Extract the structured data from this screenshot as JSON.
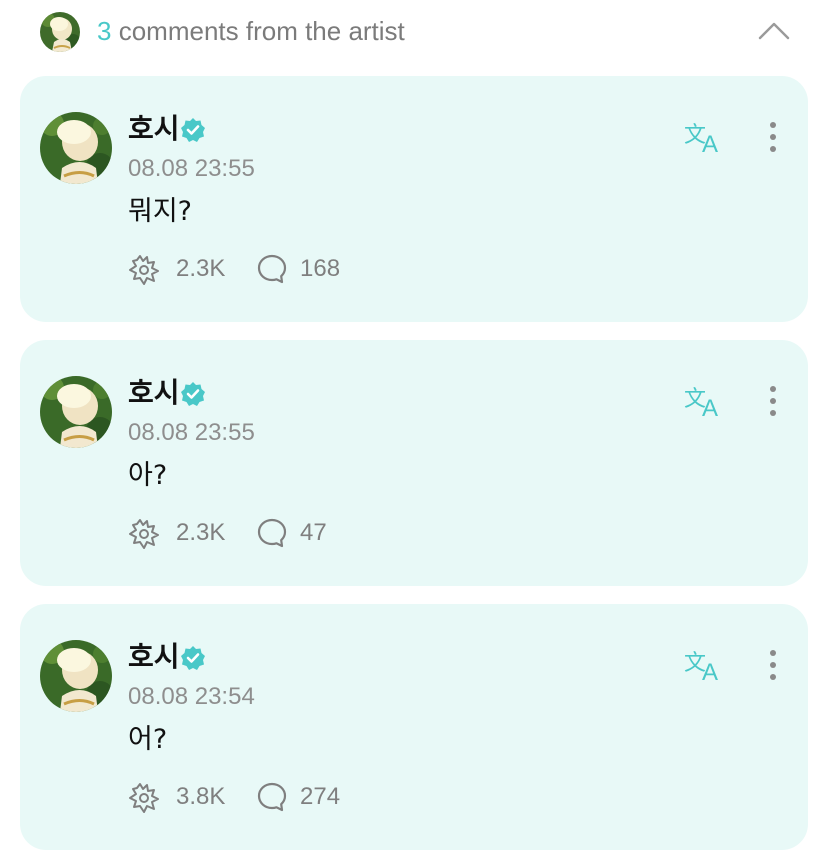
{
  "header": {
    "count": "3",
    "title_rest": "comments from the artist",
    "avatar_icon": "artist-avatar",
    "collapse_icon": "chevron-up-icon"
  },
  "colors": {
    "accent": "#49c8c8",
    "card_bg": "#e8f9f7",
    "verified": "#49c8c8",
    "muted": "#8e8e8e"
  },
  "comments": [
    {
      "name": "호시",
      "time": "08.08 23:55",
      "message": "뭐지?",
      "likes": "2.3K",
      "replies": "168"
    },
    {
      "name": "호시",
      "time": "08.08 23:55",
      "message": "아?",
      "likes": "2.3K",
      "replies": "47"
    },
    {
      "name": "호시",
      "time": "08.08 23:54",
      "message": "어?",
      "likes": "3.8K",
      "replies": "274"
    }
  ]
}
